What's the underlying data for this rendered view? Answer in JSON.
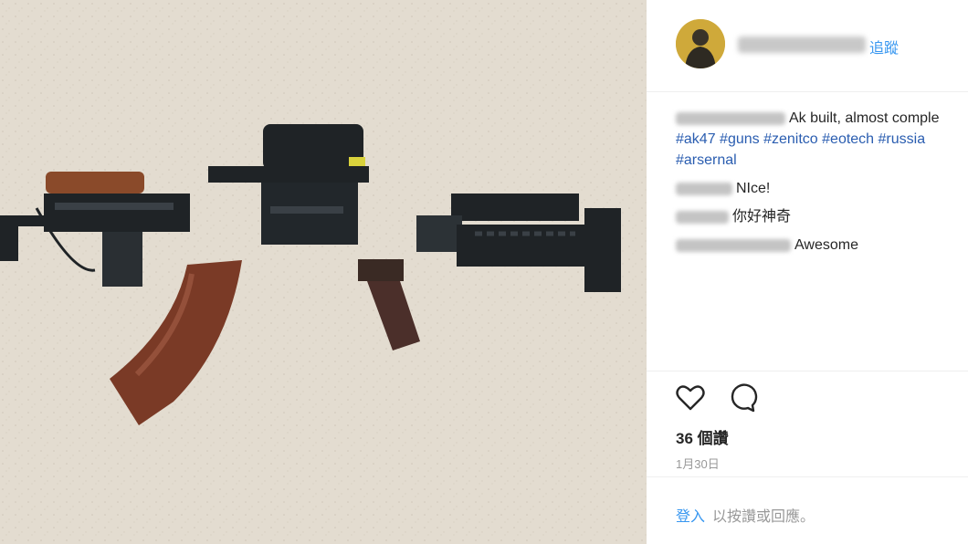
{
  "post": {
    "author_blurred": "xx_xxxxxxx0001",
    "follow_label": "追蹤",
    "caption": {
      "author_blurred": "xx_xxxxxx0002",
      "text": "Ak built, almost comple",
      "hashtags_line1": [
        "#ak47",
        "#guns",
        "#zenitco",
        "#eotech",
        "#russia"
      ],
      "hashtags_line2": [
        "#arsernal"
      ]
    },
    "comments": [
      {
        "author_blurred": "xxxxxxxx",
        "text": "NIce!"
      },
      {
        "author_blurred": "xxxxxxx",
        "text": "你好神奇"
      },
      {
        "author_blurred": "xxxxxxxxxxxxxxxx",
        "text": "Awesome"
      }
    ],
    "likes_label": "36 個讚",
    "date": "1月30日",
    "login_link": "登入",
    "login_prompt": "以按讚或回應。"
  },
  "icons": {
    "like": "heart-icon",
    "comment": "comment-icon"
  },
  "colors": {
    "link": "#3897f0",
    "hashtag": "#2a5db0",
    "muted": "#999999",
    "text": "#262626",
    "background_photo": "#e3dcd0"
  }
}
